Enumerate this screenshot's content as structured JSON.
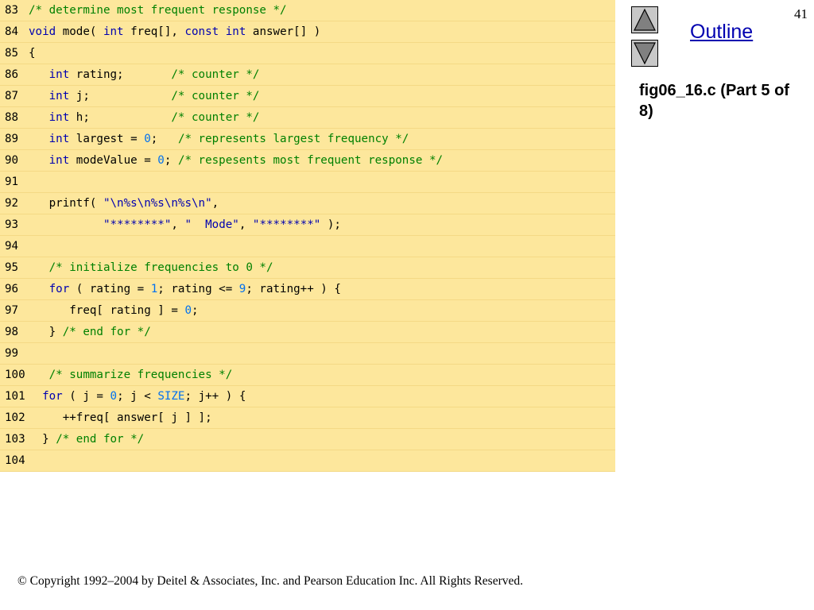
{
  "page_number": "41",
  "outline_label": "Outline",
  "caption": "fig06_16.c (Part 5 of 8)",
  "copyright": "© Copyright 1992–2004 by Deitel & Associates, Inc. and Pearson Education Inc. All Rights Reserved.",
  "navigation": {
    "up_icon": "triangle-up-icon",
    "down_icon": "triangle-down-icon"
  },
  "colors": {
    "code_background": "#fde79c",
    "keyword": "#0000b0",
    "comment": "#008000",
    "number": "#0070f0",
    "link": "#0000b0"
  },
  "code": [
    {
      "no": "83",
      "indent": "",
      "tokens": [
        [
          "c",
          "/* determine most frequent response */"
        ]
      ]
    },
    {
      "no": "84",
      "indent": "",
      "tokens": [
        [
          "k",
          "void"
        ],
        [
          "p",
          " mode( "
        ],
        [
          "k",
          "int"
        ],
        [
          "p",
          " freq[], "
        ],
        [
          "k",
          "const"
        ],
        [
          "p",
          " "
        ],
        [
          "k",
          "int"
        ],
        [
          "p",
          " answer[] )"
        ]
      ]
    },
    {
      "no": "85",
      "indent": "",
      "tokens": [
        [
          "p",
          "{"
        ]
      ]
    },
    {
      "no": "86",
      "indent": "   ",
      "tokens": [
        [
          "k",
          "int"
        ],
        [
          "p",
          " rating;       "
        ],
        [
          "c",
          "/* counter */"
        ]
      ]
    },
    {
      "no": "87",
      "indent": "   ",
      "tokens": [
        [
          "k",
          "int"
        ],
        [
          "p",
          " j;            "
        ],
        [
          "c",
          "/* counter */"
        ]
      ]
    },
    {
      "no": "88",
      "indent": "   ",
      "tokens": [
        [
          "k",
          "int"
        ],
        [
          "p",
          " h;            "
        ],
        [
          "c",
          "/* counter */"
        ]
      ]
    },
    {
      "no": "89",
      "indent": "   ",
      "tokens": [
        [
          "k",
          "int"
        ],
        [
          "p",
          " largest = "
        ],
        [
          "n",
          "0"
        ],
        [
          "p",
          ";   "
        ],
        [
          "c",
          "/* represents largest frequency */"
        ]
      ]
    },
    {
      "no": "90",
      "indent": "   ",
      "tokens": [
        [
          "k",
          "int"
        ],
        [
          "p",
          " modeValue = "
        ],
        [
          "n",
          "0"
        ],
        [
          "p",
          "; "
        ],
        [
          "c",
          "/* respesents most frequent response */"
        ]
      ]
    },
    {
      "no": "91",
      "indent": "",
      "tokens": []
    },
    {
      "no": "92",
      "indent": "   ",
      "tokens": [
        [
          "p",
          "printf( "
        ],
        [
          "s",
          "\"\\n%s\\n%s\\n%s\\n\""
        ],
        [
          "p",
          ","
        ]
      ]
    },
    {
      "no": "93",
      "indent": "           ",
      "tokens": [
        [
          "s",
          "\"********\""
        ],
        [
          "p",
          ", "
        ],
        [
          "s",
          "\"  Mode\""
        ],
        [
          "p",
          ", "
        ],
        [
          "s",
          "\"********\""
        ],
        [
          "p",
          " );"
        ]
      ]
    },
    {
      "no": "94",
      "indent": "",
      "tokens": []
    },
    {
      "no": "95",
      "indent": "   ",
      "tokens": [
        [
          "c",
          "/* initialize frequencies to 0 */"
        ]
      ]
    },
    {
      "no": "96",
      "indent": "   ",
      "tokens": [
        [
          "k",
          "for"
        ],
        [
          "p",
          " ( rating = "
        ],
        [
          "n",
          "1"
        ],
        [
          "p",
          "; rating <= "
        ],
        [
          "n",
          "9"
        ],
        [
          "p",
          "; rating++ ) {"
        ]
      ]
    },
    {
      "no": "97",
      "indent": "      ",
      "tokens": [
        [
          "p",
          "freq[ rating ] = "
        ],
        [
          "n",
          "0"
        ],
        [
          "p",
          ";"
        ]
      ]
    },
    {
      "no": "98",
      "indent": "   ",
      "tokens": [
        [
          "p",
          "} "
        ],
        [
          "c",
          "/* end for */"
        ]
      ]
    },
    {
      "no": "99",
      "indent": "",
      "tokens": []
    },
    {
      "no": "100",
      "indent": "   ",
      "tokens": [
        [
          "c",
          "/* summarize frequencies */"
        ]
      ]
    },
    {
      "no": "101",
      "indent": "  ",
      "tokens": [
        [
          "k",
          "for"
        ],
        [
          "p",
          " ( j = "
        ],
        [
          "n",
          "0"
        ],
        [
          "p",
          "; j < "
        ],
        [
          "n",
          "SIZE"
        ],
        [
          "p",
          "; j++ ) {"
        ]
      ]
    },
    {
      "no": "102",
      "indent": "     ",
      "tokens": [
        [
          "p",
          "++freq[ answer[ j ] ];"
        ]
      ]
    },
    {
      "no": "103",
      "indent": "  ",
      "tokens": [
        [
          "p",
          "} "
        ],
        [
          "c",
          "/* end for */"
        ]
      ]
    },
    {
      "no": "104",
      "indent": "",
      "tokens": []
    }
  ]
}
